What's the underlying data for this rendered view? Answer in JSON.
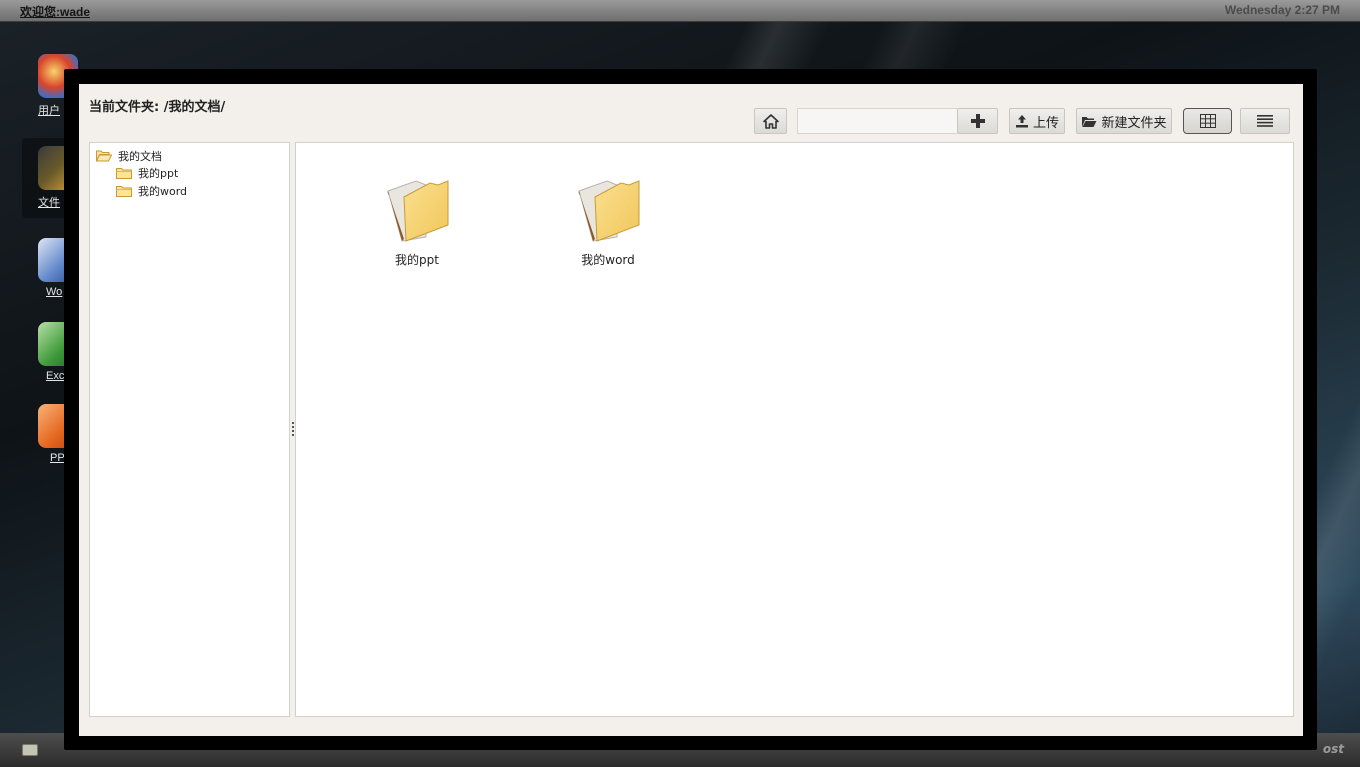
{
  "topbar": {
    "welcome": "欢迎您:wade",
    "clock": "Wednesday 2:27 PM"
  },
  "desktop": {
    "icons": [
      {
        "label": "用户",
        "icon": "users-app-icon"
      },
      {
        "label": "文件",
        "icon": "file-manager-app-icon",
        "selected": true
      },
      {
        "label": "Wo",
        "icon": "word-app-icon"
      },
      {
        "label": "Exc",
        "icon": "excel-app-icon"
      },
      {
        "label": "PP",
        "icon": "powerpoint-app-icon"
      }
    ]
  },
  "taskbar": {
    "brand": "ost"
  },
  "filemanager": {
    "path_label": "当前文件夹: /我的文档/",
    "toolbar": {
      "home_icon": "home-icon",
      "search_value": "",
      "search_placeholder": "",
      "add_icon": "plus-icon",
      "upload_label": "上传",
      "new_folder_label": "新建文件夹",
      "grid_view_icon": "grid-view-icon",
      "list_view_icon": "list-view-icon",
      "active_view": "grid"
    },
    "tree": {
      "root": {
        "label": "我的文档",
        "icon": "folder-open-icon"
      },
      "children": [
        {
          "label": "我的ppt",
          "icon": "folder-icon"
        },
        {
          "label": "我的word",
          "icon": "folder-icon"
        }
      ]
    },
    "items": [
      {
        "name": "我的ppt",
        "icon": "folder-icon"
      },
      {
        "name": "我的word",
        "icon": "folder-icon"
      }
    ]
  },
  "colors": {
    "window_bg": "#f3f0eb",
    "panel_bg": "#ffffff",
    "folder_yellow": "#f5cf6b",
    "topbar_gray": "#8a8a8a"
  }
}
